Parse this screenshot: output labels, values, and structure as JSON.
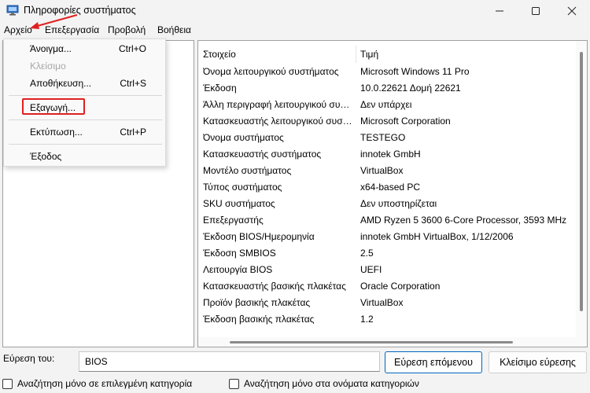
{
  "window": {
    "title": "Πληροφορίες συστήματος"
  },
  "menubar": {
    "file": "Αρχείο",
    "edit": "Επεξεργασία",
    "view": "Προβολή",
    "help": "Βοήθεια"
  },
  "dropdown": {
    "items": [
      {
        "label": "Άνοιγμα...",
        "shortcut": "Ctrl+O",
        "disabled": false
      },
      {
        "label": "Κλείσιμο",
        "shortcut": "",
        "disabled": true
      },
      {
        "label": "Αποθήκευση...",
        "shortcut": "Ctrl+S",
        "disabled": false
      },
      {
        "label": "Εξαγωγή...",
        "shortcut": "",
        "disabled": false
      },
      {
        "label": "Εκτύπωση...",
        "shortcut": "Ctrl+P",
        "disabled": false
      },
      {
        "label": "Έξοδος",
        "shortcut": "",
        "disabled": false
      }
    ]
  },
  "table": {
    "headers": {
      "item": "Στοιχείο",
      "value": "Τιμή"
    },
    "rows": [
      {
        "item": "Όνομα λειτουργικού συστήματος",
        "value": "Microsoft Windows 11 Pro"
      },
      {
        "item": "Έκδοση",
        "value": "10.0.22621 Δομή 22621"
      },
      {
        "item": "Άλλη περιγραφή λειτουργικού συστήματος",
        "value": "Δεν υπάρχει"
      },
      {
        "item": "Κατασκευαστής λειτουργικού συστήματος",
        "value": "Microsoft Corporation"
      },
      {
        "item": "Όνομα συστήματος",
        "value": "TESTEGO"
      },
      {
        "item": "Κατασκευαστής συστήματος",
        "value": "innotek GmbH"
      },
      {
        "item": "Μοντέλο συστήματος",
        "value": "VirtualBox"
      },
      {
        "item": "Τύπος συστήματος",
        "value": "x64-based PC"
      },
      {
        "item": "SKU συστήματος",
        "value": "Δεν υποστηρίζεται"
      },
      {
        "item": "Επεξεργαστής",
        "value": "AMD Ryzen 5 3600 6-Core Processor, 3593 MHz"
      },
      {
        "item": "Έκδοση BIOS/Ημερομηνία",
        "value": "innotek GmbH VirtualBox, 1/12/2006"
      },
      {
        "item": "Έκδοση SMBIOS",
        "value": "2.5"
      },
      {
        "item": "Λειτουργία BIOS",
        "value": "UEFI"
      },
      {
        "item": "Κατασκευαστής βασικής πλακέτας",
        "value": "Oracle Corporation"
      },
      {
        "item": "Προϊόν βασικής πλακέτας",
        "value": "VirtualBox"
      },
      {
        "item": "Έκδοση βασικής πλακέτας",
        "value": "1.2"
      }
    ]
  },
  "search": {
    "label": "Εύρεση του:",
    "value": "BIOS",
    "find_next": "Εύρεση επόμενου",
    "close_find": "Κλείσιμο εύρεσης",
    "only_selected": "Αναζήτηση μόνο σε επιλεγμένη κατηγορία",
    "only_names": "Αναζήτηση μόνο στα ονόματα κατηγοριών"
  },
  "colors": {
    "highlight": "#e02020",
    "accent": "#0067c0"
  }
}
